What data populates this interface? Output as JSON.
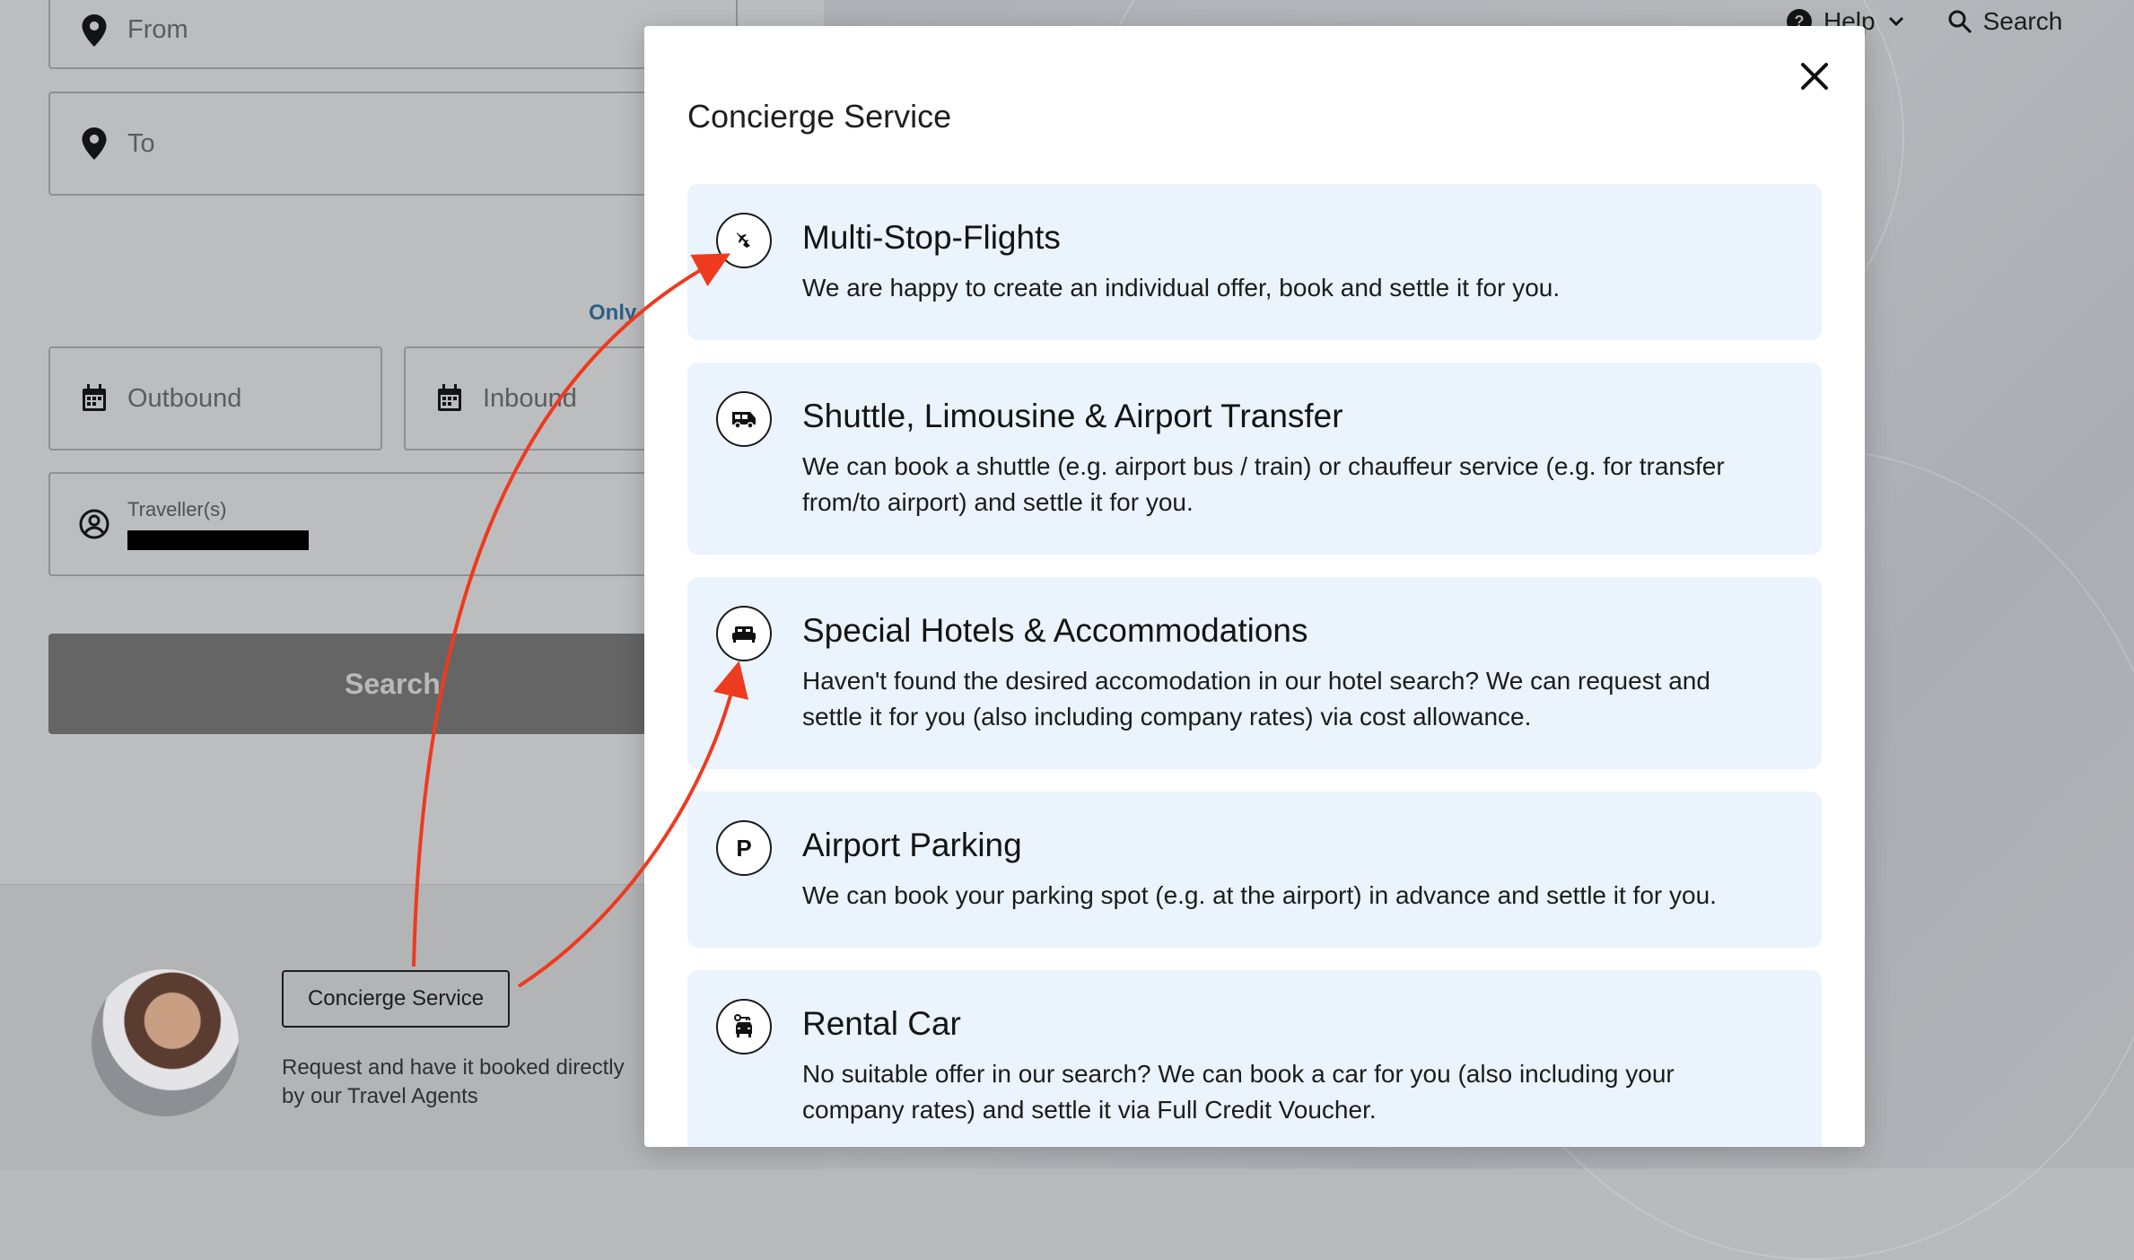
{
  "form": {
    "from_placeholder": "From",
    "to_placeholder": "To",
    "only_link": "Only",
    "outbound_label": "Outbound",
    "inbound_label": "Inbound",
    "traveller_label": "Traveller(s)",
    "search_button": "Search"
  },
  "agent": {
    "concierge_button": "Concierge Service",
    "text": "Request and have it booked directly by our Travel Agents"
  },
  "topnav": {
    "help": "Help",
    "search": "Search"
  },
  "modal": {
    "title": "Concierge Service",
    "services": [
      {
        "icon": "multi-stop-flight-icon",
        "title": "Multi-Stop-Flights",
        "description": "We are happy to create an individual offer, book and settle it for you."
      },
      {
        "icon": "shuttle-bus-icon",
        "title": "Shuttle, Limousine & Airport Transfer",
        "description": "We can book a shuttle (e.g. airport bus / train) or chauffeur service (e.g. for transfer from/to airport) and settle it for you."
      },
      {
        "icon": "hotel-bed-icon",
        "title": "Special Hotels & Accommodations",
        "description": "Haven't found the desired accomodation in our hotel search? We can request and settle it for you (also including company rates) via cost allowance."
      },
      {
        "icon": "parking-icon",
        "title": "Airport Parking",
        "description": "We can book your parking spot (e.g. at the airport) in advance and settle it for you."
      },
      {
        "icon": "rental-car-icon",
        "title": "Rental Car",
        "description": "No suitable offer in our search? We can book a car for you (also including your company rates) and settle it via Full Credit Voucher."
      }
    ]
  },
  "colors": {
    "card_background": "#ebf3fc",
    "annotation_arrow": "#ee3a1e",
    "link": "#2c5f86"
  }
}
